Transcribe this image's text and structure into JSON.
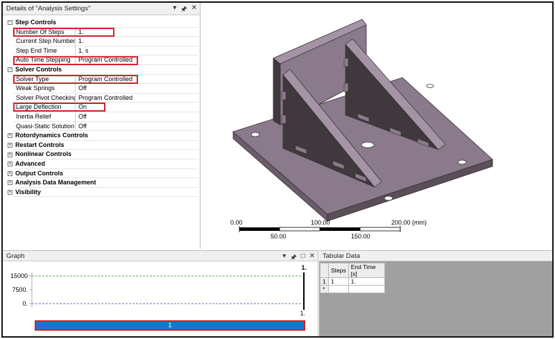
{
  "details": {
    "title": "Details of \"Analysis Settings\"",
    "pin_glyph": "▾ 1",
    "groups": [
      {
        "label": "Step Controls",
        "expanded": true,
        "props": [
          {
            "label": "Number Of Steps",
            "value": "1."
          },
          {
            "label": "Current Step Number",
            "value": "1."
          },
          {
            "label": "Step End Time",
            "value": "1. s"
          },
          {
            "label": "Auto Time Stepping",
            "value": "Program Controlled"
          }
        ]
      },
      {
        "label": "Solver Controls",
        "expanded": true,
        "props": [
          {
            "label": "Solver Type",
            "value": "Program Controlled"
          },
          {
            "label": "Weak Springs",
            "value": "Off"
          },
          {
            "label": "Solver Pivot Checking",
            "value": "Program Controlled"
          },
          {
            "label": "Large Deflection",
            "value": "On"
          },
          {
            "label": "Inertia Relief",
            "value": "Off"
          },
          {
            "label": "Quasi-Static Solution",
            "value": "Off"
          }
        ]
      },
      {
        "label": "Rotordynamics Controls",
        "expanded": false
      },
      {
        "label": "Restart Controls",
        "expanded": false
      },
      {
        "label": "Nonlinear Controls",
        "expanded": false
      },
      {
        "label": "Advanced",
        "expanded": false
      },
      {
        "label": "Output Controls",
        "expanded": false
      },
      {
        "label": "Analysis Data Management",
        "expanded": false
      },
      {
        "label": "Visibility",
        "expanded": false
      }
    ]
  },
  "viewport": {
    "scale": {
      "top_labels": [
        "0.00",
        "100.00",
        "200.00 (mm)"
      ],
      "bottom_labels": [
        "50.00",
        "150.00"
      ]
    },
    "colors": {
      "model": "#8b7a8b",
      "model_dark": "#3f383d",
      "model_light": "#a594a5"
    }
  },
  "graph": {
    "title": "Graph",
    "y_ticks": [
      "15000",
      "7500.",
      "0."
    ],
    "top_right": "1.",
    "bottom_right": "1.",
    "step_label": "1",
    "colors": {
      "step_bar": "#1a73d1",
      "highlight": "#d4202a"
    }
  },
  "tabular": {
    "title": "Tabular Data",
    "headers": [
      "Steps",
      "End Time [s]"
    ],
    "rows": [
      {
        "rh": "1",
        "cells": [
          "1",
          "1."
        ]
      },
      {
        "rh": "*",
        "cells": [
          "",
          ""
        ]
      }
    ]
  }
}
